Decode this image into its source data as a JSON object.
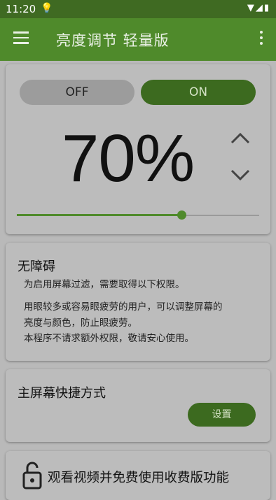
{
  "statusbar": {
    "time": "11:20",
    "bulb_icon": "💡",
    "icons": "▼◢▮"
  },
  "toolbar": {
    "title": "亮度调节 轻量版"
  },
  "brightness": {
    "off_label": "OFF",
    "on_label": "ON",
    "percent_text": "70%",
    "level": 0.68
  },
  "accessibility": {
    "title": "无障碍",
    "line1": "为启用屏幕过滤，需要取得以下权限。",
    "line2": "用眼较多或容易眼疲劳的用户，可以调整屏幕的",
    "line3": "亮度与颜色，防止眼疲劳。",
    "line4": "本程序不请求额外权限，敬请安心使用。"
  },
  "shortcut": {
    "title": "主屏幕快捷方式",
    "button_label": "设置"
  },
  "promo": {
    "text": "观看视频并免费使用收费版功能"
  },
  "colors": {
    "primary": "#4f8a2b",
    "status": "#3f6a22",
    "on_button": "#3c6a1f"
  }
}
